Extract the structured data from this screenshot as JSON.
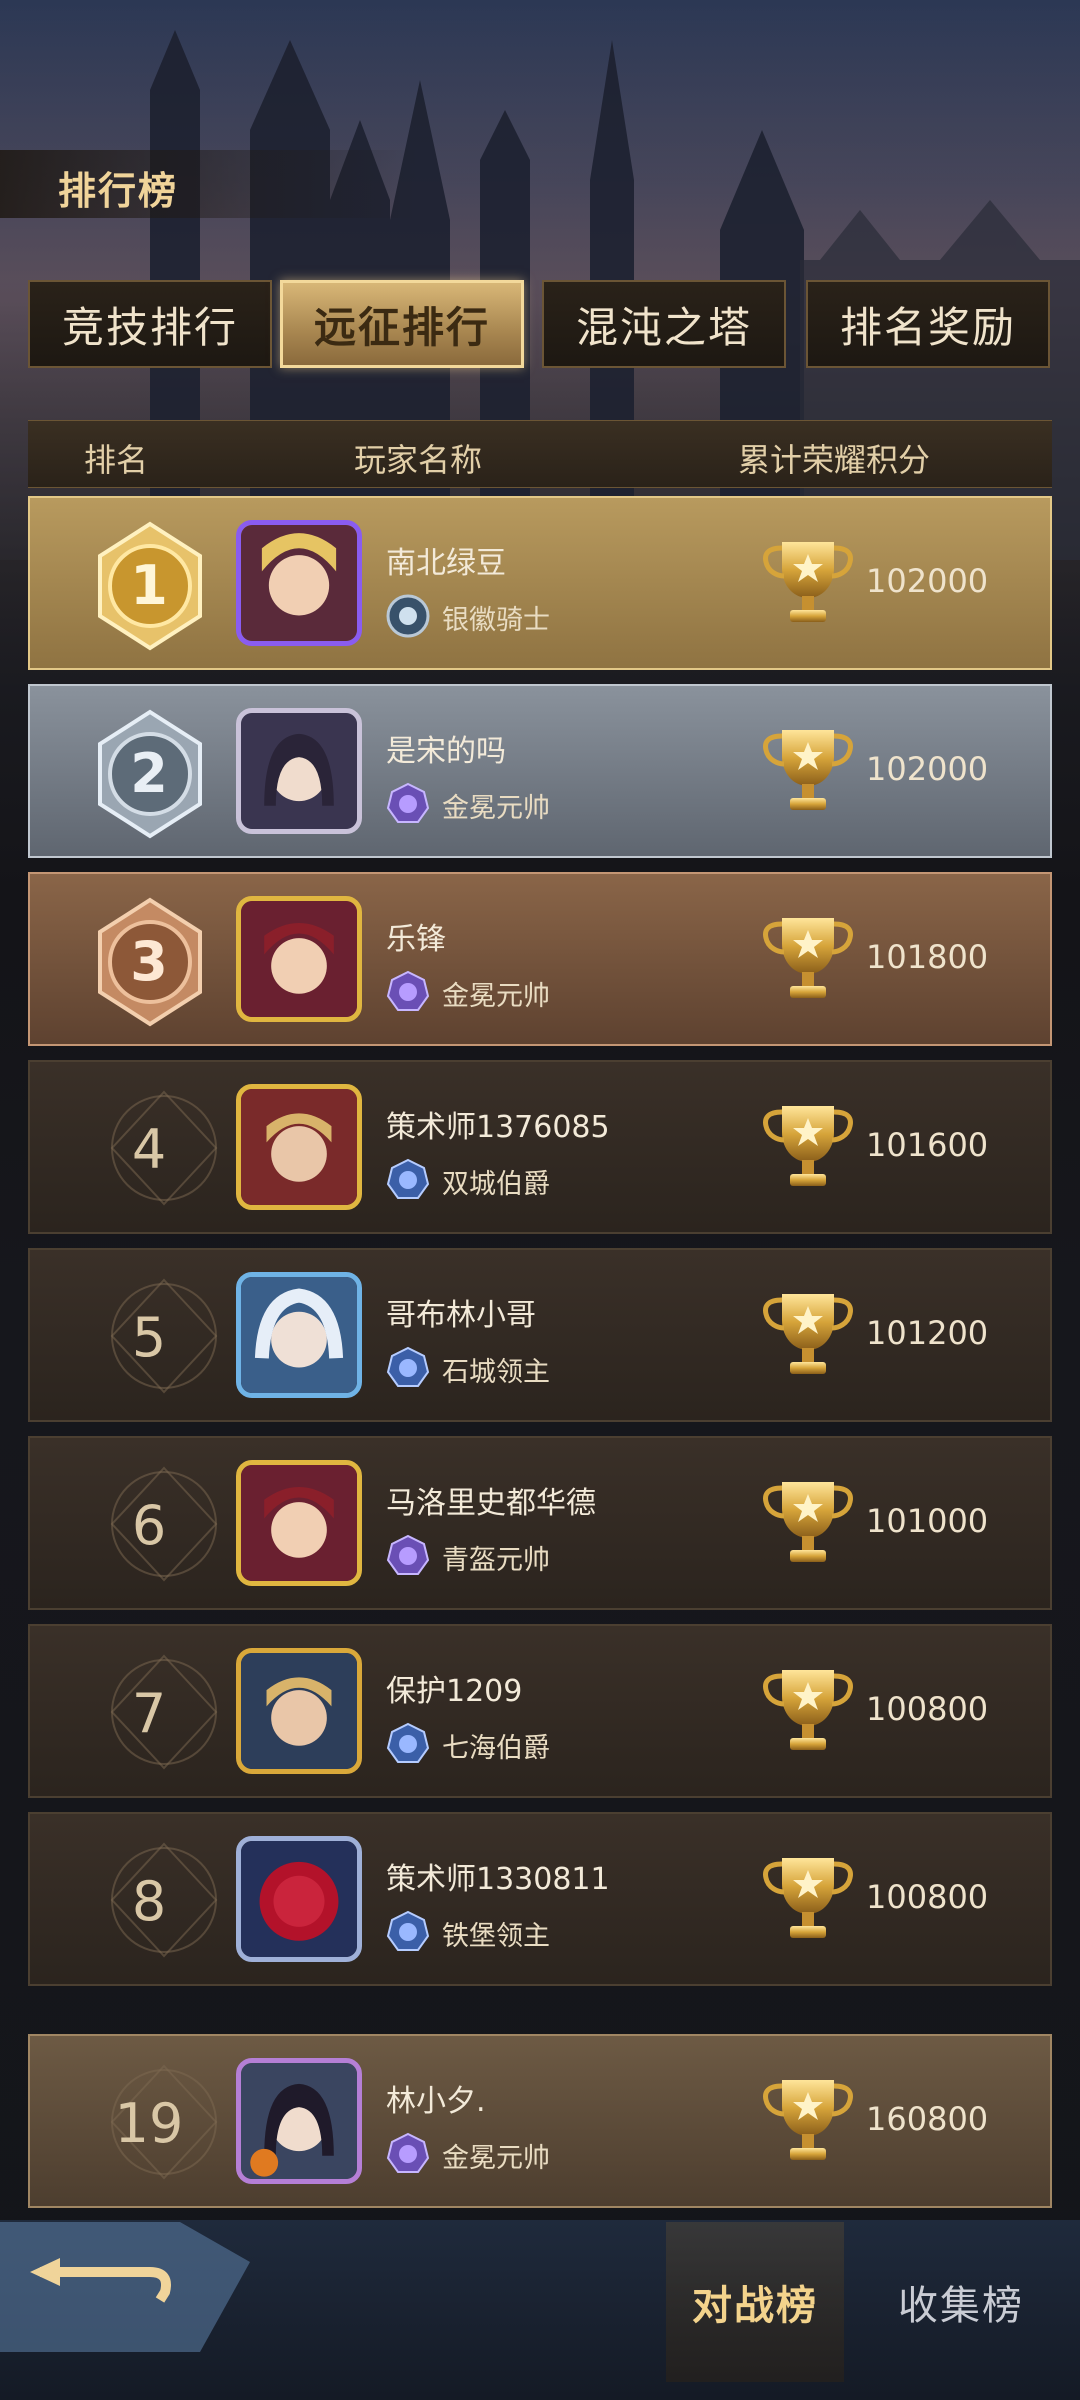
{
  "header": {
    "title": "排行榜"
  },
  "tabs": [
    {
      "label": "竞技排行",
      "active": false
    },
    {
      "label": "远征排行",
      "active": true
    },
    {
      "label": "混沌之塔",
      "active": false
    },
    {
      "label": "排名奖励",
      "active": false
    }
  ],
  "columns": {
    "rank": "排名",
    "player": "玩家名称",
    "score": "累计荣耀积分"
  },
  "rows": [
    {
      "rank": "1",
      "name": "南北绿豆",
      "title": "银徽骑士",
      "score": "102000"
    },
    {
      "rank": "2",
      "name": "是宋的吗",
      "title": "金冕元帅",
      "score": "102000"
    },
    {
      "rank": "3",
      "name": "乐锋",
      "title": "金冕元帅",
      "score": "101800"
    },
    {
      "rank": "4",
      "name": "策术师1376085",
      "title": "双城伯爵",
      "score": "101600"
    },
    {
      "rank": "5",
      "name": "哥布林小哥",
      "title": "石城领主",
      "score": "101200"
    },
    {
      "rank": "6",
      "name": "马洛里史都华德",
      "title": "青盔元帅",
      "score": "101000"
    },
    {
      "rank": "7",
      "name": "保护1209",
      "title": "七海伯爵",
      "score": "100800"
    },
    {
      "rank": "8",
      "name": "策术师1330811",
      "title": "铁堡领主",
      "score": "100800"
    }
  ],
  "self_row": {
    "rank": "19",
    "name": "林小夕.",
    "title": "金冕元帅",
    "score": "160800"
  },
  "bottom_tabs": [
    {
      "label": "对战榜",
      "active": true
    },
    {
      "label": "收集榜",
      "active": false
    }
  ],
  "colors": {
    "gold": "#f0d49a",
    "panel": "#2b241e",
    "accent": "#e3c887"
  }
}
